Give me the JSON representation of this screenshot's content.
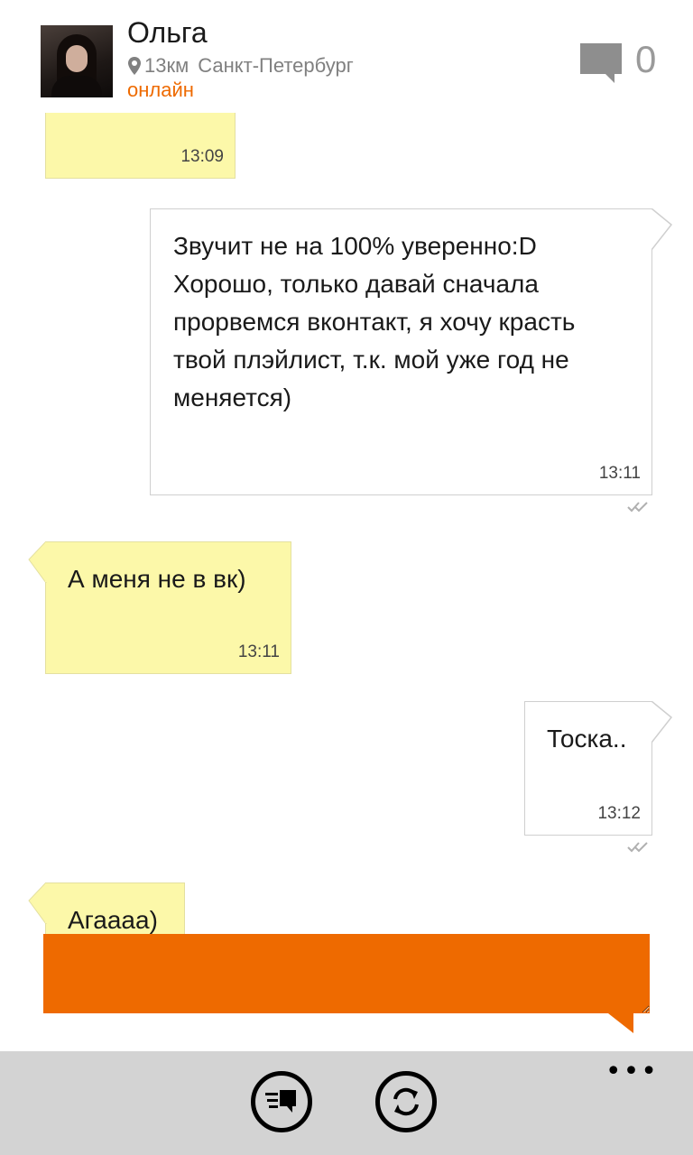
{
  "contact": {
    "name": "Ольга",
    "distance": "13км",
    "city": "Санкт-Петербург",
    "status": "онлайн",
    "message_count": "0"
  },
  "messages": [
    {
      "direction": "in",
      "text": "",
      "time": "13:09"
    },
    {
      "direction": "out",
      "lines": [
        "Звучит не на 100% уверенно:D",
        "Хорошо, только давай сначала",
        "прорвемся вконтакт, я хочу красть",
        "твой плэйлист, т.к. мой уже год не",
        "меняется)"
      ],
      "time": "13:11"
    },
    {
      "direction": "in",
      "text": "А меня не в вк)",
      "time": "13:11"
    },
    {
      "direction": "out",
      "text": "Тоска..",
      "time": "13:12"
    },
    {
      "direction": "in",
      "text": "Агаааа)",
      "time": ""
    }
  ],
  "compose": {
    "value": ""
  },
  "appbar": {
    "buttons": [
      "chat-list-icon",
      "refresh-icon"
    ],
    "more": "•••"
  },
  "colors": {
    "accent": "#ee6a00",
    "incoming": "#fcf8a9",
    "appbar": "#d3d3d3"
  }
}
